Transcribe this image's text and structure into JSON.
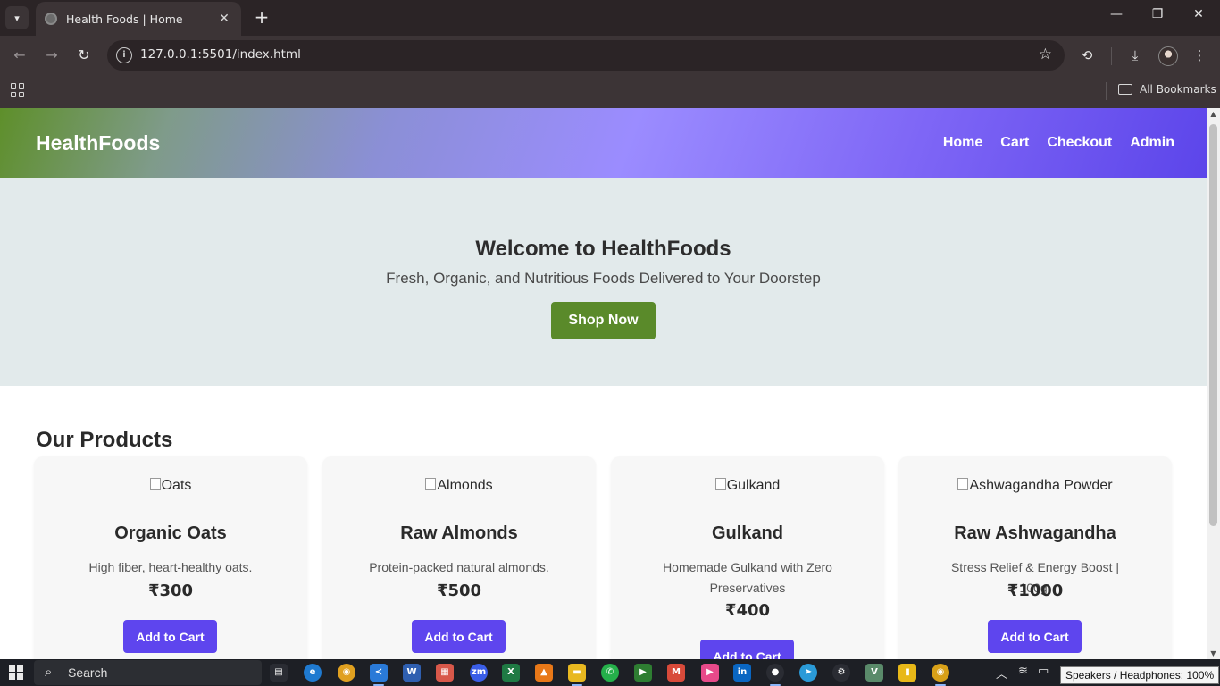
{
  "browser": {
    "tab_title": "Health Foods | Home",
    "url": "127.0.0.1:5501/index.html",
    "bookmarks_label": "All Bookmarks"
  },
  "site": {
    "logo": "HealthFoods",
    "nav": [
      "Home",
      "Cart",
      "Checkout",
      "Admin"
    ],
    "hero": {
      "title": "Welcome to HealthFoods",
      "subtitle": "Fresh, Organic, and Nutritious Foods Delivered to Your Doorstep",
      "cta": "Shop Now"
    },
    "products_heading": "Our Products",
    "products": [
      {
        "image_alt": "Oats",
        "name": "Organic Oats",
        "description": "High fiber, heart-healthy oats.",
        "price": "₹300",
        "button": "Add to Cart"
      },
      {
        "image_alt": "Almonds",
        "name": "Raw Almonds",
        "description": "Protein-packed natural almonds.",
        "price": "₹500",
        "button": "Add to Cart"
      },
      {
        "image_alt": "Gulkand",
        "name": "Gulkand",
        "description": "Homemade Gulkand with Zero Preservatives",
        "price": "₹400",
        "button": "Add to Cart"
      },
      {
        "image_alt": "Ashwagandha Powder",
        "name": "Raw Ashwagandha",
        "description": "Stress Relief & Energy Boost | 100g.",
        "price": "₹1000",
        "button": "Add to Cart"
      }
    ]
  },
  "taskbar": {
    "search_label": "Search",
    "tooltip": "Speakers / Headphones: 100%"
  },
  "colors": {
    "header_start": "#5e8f2a",
    "header_end": "#5c45ea",
    "shop_button": "#5a8a2a",
    "cart_button": "#5e45ee",
    "hero_bg": "#e2eaeb"
  }
}
